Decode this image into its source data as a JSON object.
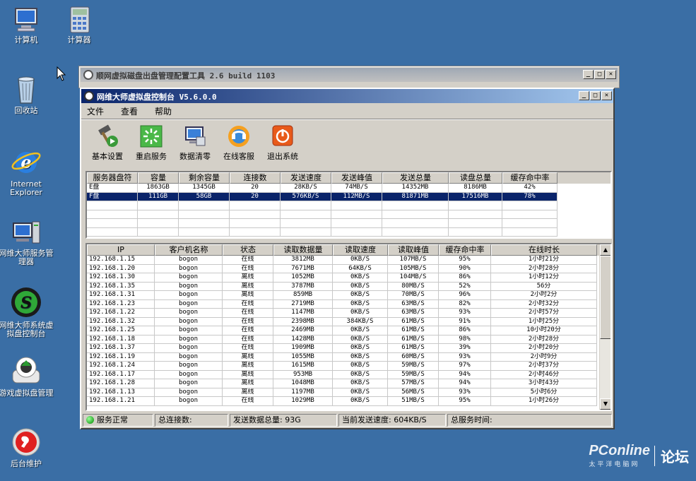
{
  "desktop": {
    "icons": [
      {
        "label": "计算机",
        "icon": "computer-icon"
      },
      {
        "label": "计算器",
        "icon": "calculator-icon"
      },
      {
        "label": "回收站",
        "icon": "recycle-bin-icon"
      },
      {
        "label": "Internet Explorer",
        "icon": "ie-icon"
      },
      {
        "label": "网维大师服务管理器",
        "icon": "server-manager-icon"
      },
      {
        "label": "网维大师系统虚拟盘控制台",
        "icon": "virtual-disk-icon"
      },
      {
        "label": "游戏虚拟盘管理",
        "icon": "game-disk-icon"
      },
      {
        "label": "后台维护",
        "icon": "maintenance-icon"
      }
    ]
  },
  "back_window": {
    "title": "顺网虚拟磁盘出盘管理配置工具 2.6 build 1103"
  },
  "main_window": {
    "title": "网维大师虚拟盘控制台 V5.6.0.0",
    "menu": [
      "文件",
      "查看",
      "帮助"
    ],
    "toolbar": [
      {
        "label": "基本设置",
        "icon": "settings-hammer-icon"
      },
      {
        "label": "重启服务",
        "icon": "restart-icon"
      },
      {
        "label": "数据清零",
        "icon": "clear-data-icon"
      },
      {
        "label": "在线客服",
        "icon": "online-service-icon"
      },
      {
        "label": "退出系统",
        "icon": "power-icon"
      }
    ],
    "disk_table": {
      "columns": [
        "服务器盘符",
        "容量",
        "剩余容量",
        "连接数",
        "发送速度",
        "发送峰值",
        "发送总量",
        "读盘总量",
        "缓存命中率"
      ],
      "rows": [
        [
          "E盘",
          "1863GB",
          "1345GB",
          "20",
          "28KB/S",
          "74MB/S",
          "14352MB",
          "8186MB",
          "42%"
        ],
        [
          "F盘",
          "111GB",
          "58GB",
          "20",
          "576KB/S",
          "112MB/S",
          "81871MB",
          "17516MB",
          "78%"
        ]
      ],
      "selected_row": 1
    },
    "client_table": {
      "columns": [
        "IP",
        "客户机名称",
        "状态",
        "读取数据量",
        "读取速度",
        "读取峰值",
        "缓存命中率",
        "在线时长"
      ],
      "rows": [
        [
          "192.168.1.15",
          "bogon",
          "在线",
          "3812MB",
          "0KB/S",
          "107MB/S",
          "95%",
          "1小时21分"
        ],
        [
          "192.168.1.20",
          "bogon",
          "在线",
          "7671MB",
          "64KB/S",
          "105MB/S",
          "90%",
          "2小时28分"
        ],
        [
          "192.168.1.30",
          "bogon",
          "离线",
          "1052MB",
          "0KB/S",
          "104MB/S",
          "86%",
          "1小时12分"
        ],
        [
          "192.168.1.35",
          "bogon",
          "离线",
          "3787MB",
          "0KB/S",
          "80MB/S",
          "52%",
          "56分"
        ],
        [
          "192.168.1.31",
          "bogon",
          "离线",
          "859MB",
          "0KB/S",
          "70MB/S",
          "96%",
          "2小时2分"
        ],
        [
          "192.168.1.23",
          "bogon",
          "在线",
          "2719MB",
          "0KB/S",
          "63MB/S",
          "82%",
          "2小时32分"
        ],
        [
          "192.168.1.22",
          "bogon",
          "在线",
          "1147MB",
          "0KB/S",
          "63MB/S",
          "93%",
          "2小时57分"
        ],
        [
          "192.168.1.32",
          "bogon",
          "在线",
          "2398MB",
          "384KB/S",
          "61MB/S",
          "91%",
          "1小时25分"
        ],
        [
          "192.168.1.25",
          "bogon",
          "在线",
          "2469MB",
          "0KB/S",
          "61MB/S",
          "86%",
          "10小时20分"
        ],
        [
          "192.168.1.18",
          "bogon",
          "在线",
          "1428MB",
          "0KB/S",
          "61MB/S",
          "98%",
          "2小时28分"
        ],
        [
          "192.168.1.37",
          "bogon",
          "在线",
          "1909MB",
          "0KB/S",
          "61MB/S",
          "39%",
          "2小时20分"
        ],
        [
          "192.168.1.19",
          "bogon",
          "离线",
          "1055MB",
          "0KB/S",
          "60MB/S",
          "93%",
          "2小时9分"
        ],
        [
          "192.168.1.24",
          "bogon",
          "离线",
          "1615MB",
          "0KB/S",
          "59MB/S",
          "97%",
          "2小时37分"
        ],
        [
          "192.168.1.17",
          "bogon",
          "离线",
          "953MB",
          "0KB/S",
          "59MB/S",
          "94%",
          "2小时46分"
        ],
        [
          "192.168.1.28",
          "bogon",
          "离线",
          "1048MB",
          "0KB/S",
          "57MB/S",
          "94%",
          "3小时43分"
        ],
        [
          "192.168.1.13",
          "bogon",
          "离线",
          "1197MB",
          "0KB/S",
          "56MB/S",
          "93%",
          "5小时6分"
        ],
        [
          "192.168.1.21",
          "bogon",
          "在线",
          "1029MB",
          "0KB/S",
          "51MB/S",
          "95%",
          "1小时26分"
        ]
      ]
    },
    "statusbar": {
      "service": "服务正常",
      "total_connections": "总连接数:",
      "send_total": "发送数据总量: 93G",
      "current_speed": "当前发送速度: 604KB/S",
      "total_time": "总服务时间:"
    }
  },
  "watermark": {
    "logo": "PConline",
    "sub": "太平洋电脑网",
    "forum": "论坛"
  },
  "colors": {
    "desktop": "#3a6ea5",
    "title_active": "#0a246a",
    "selection": "#0a246a",
    "window_face": "#d4d0c8"
  }
}
